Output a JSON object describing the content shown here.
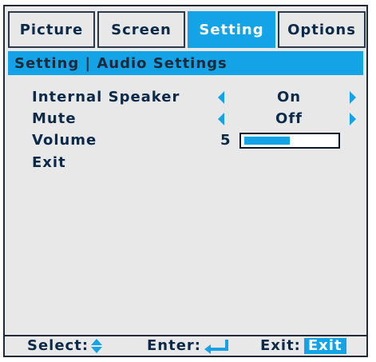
{
  "tabs": [
    {
      "label": "Picture",
      "active": false
    },
    {
      "label": "Screen",
      "active": false
    },
    {
      "label": "Setting",
      "active": true
    },
    {
      "label": "Options",
      "active": false
    }
  ],
  "title": "Setting | Audio Settings",
  "rows": {
    "internal_speaker": {
      "label": "Internal Speaker",
      "value": "On"
    },
    "mute": {
      "label": "Mute",
      "value": "Off"
    },
    "volume": {
      "label": "Volume",
      "value": "5",
      "level_fraction": 0.5
    },
    "exit": {
      "label": "Exit"
    }
  },
  "status": {
    "select_label": "Select:",
    "enter_label": "Enter:",
    "exit_label": "Exit:",
    "exit_badge": "Exit"
  },
  "colors": {
    "accent": "#14a3e6",
    "background": "#e8e8e8",
    "text": "#0b2a4a"
  },
  "icons": {
    "left_arrow": "triangle-left",
    "right_arrow": "triangle-right",
    "select": "up-down-arrows",
    "enter": "enter-return-arrow"
  }
}
